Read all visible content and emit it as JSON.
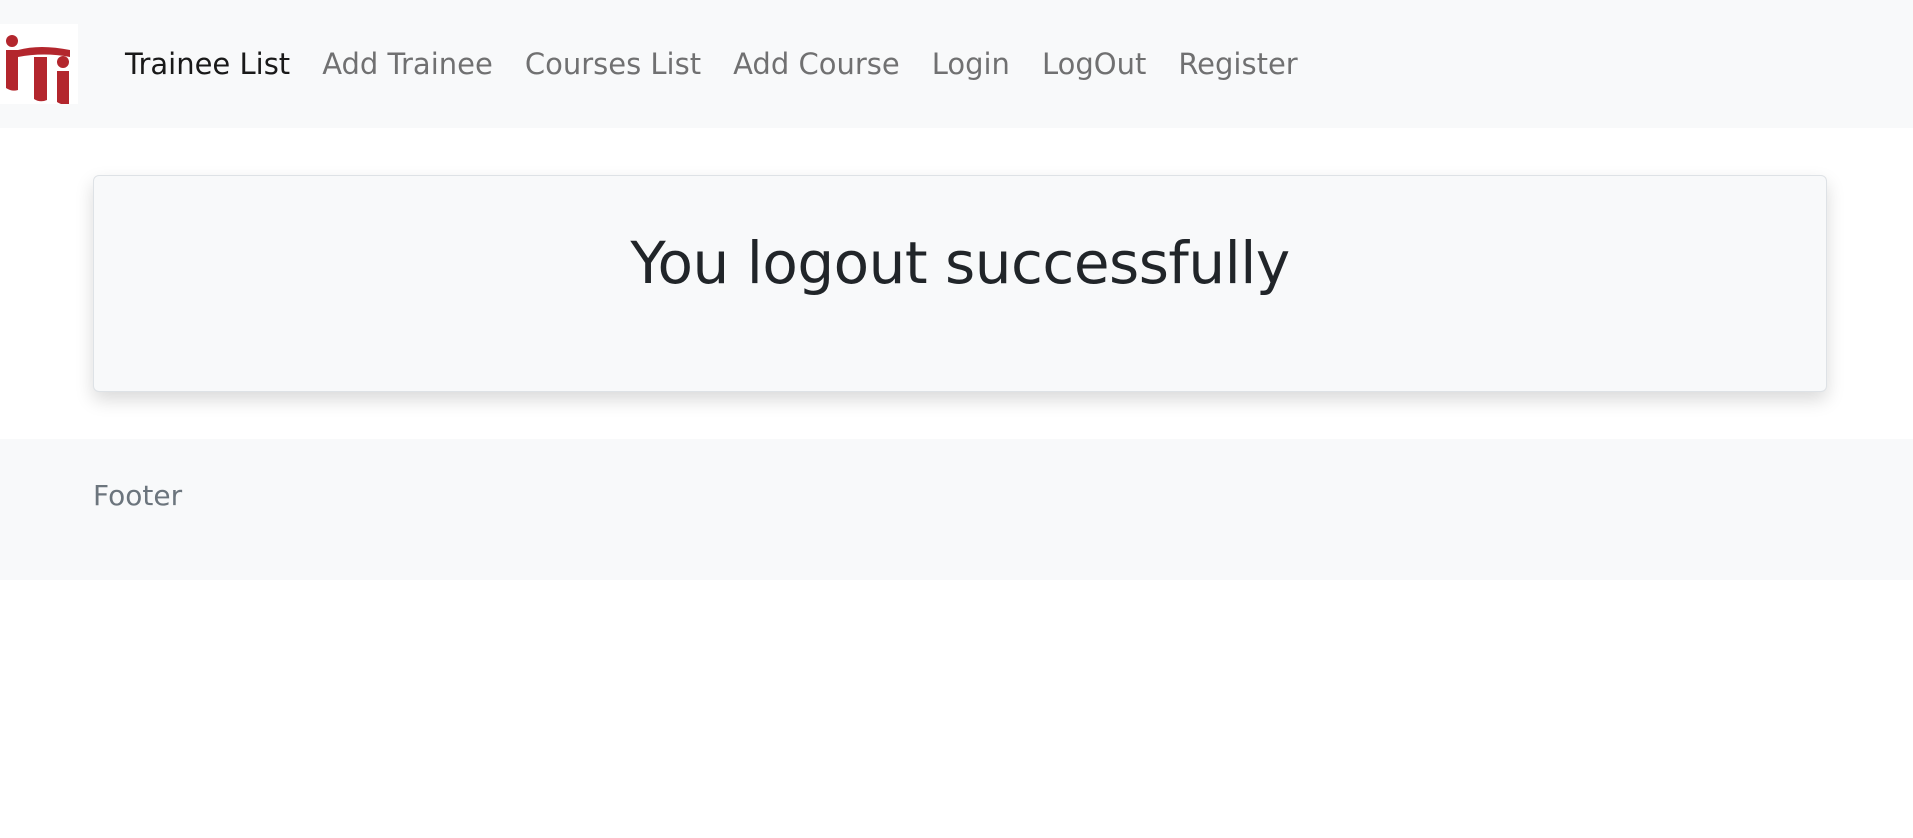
{
  "navbar": {
    "logo_alt": "iti logo",
    "items": [
      {
        "label": "Trainee List",
        "active": true
      },
      {
        "label": "Add Trainee",
        "active": false
      },
      {
        "label": "Courses List",
        "active": false
      },
      {
        "label": "Add Course",
        "active": false
      },
      {
        "label": "Login",
        "active": false
      },
      {
        "label": "LogOut",
        "active": false
      },
      {
        "label": "Register",
        "active": false
      }
    ]
  },
  "main": {
    "message": "You logout successfully"
  },
  "footer": {
    "text": "Footer"
  },
  "colors": {
    "logo_red": "#b3262d",
    "nav_bg": "#f8f9fa",
    "footer_text": "#6c757d"
  }
}
